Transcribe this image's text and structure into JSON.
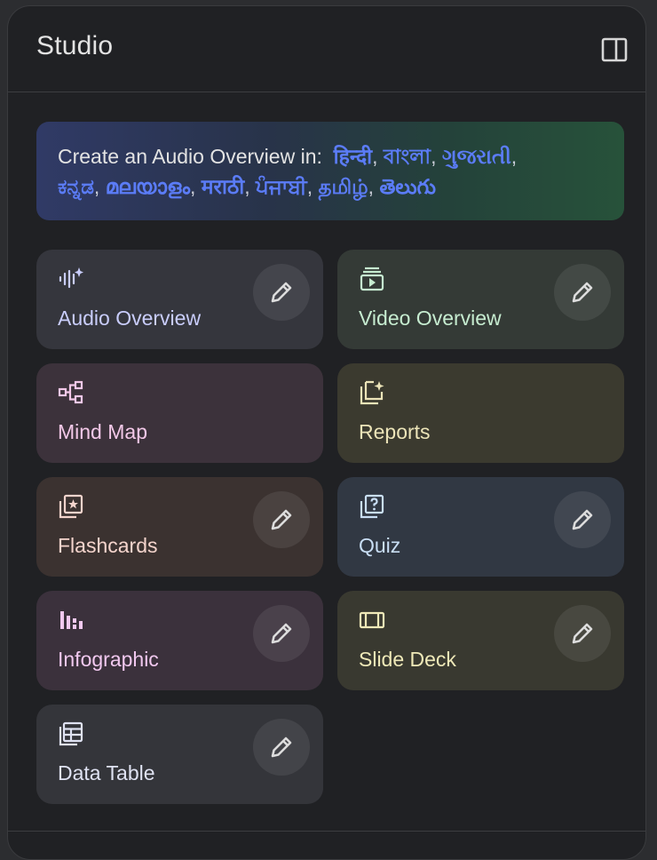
{
  "header": {
    "title": "Studio",
    "collapse_icon": "panel-toggle-icon"
  },
  "banner": {
    "prefix": "Create an Audio Overview in:",
    "languages": [
      "हिन्दी",
      "বাংলা",
      "ગુજરાતી",
      "ಕನ್ನಡ",
      "മലയാളം",
      "मराठी",
      "ਪੰਜਾਬੀ",
      "தமிழ்",
      "తెలుగు"
    ],
    "separator": ",",
    "link_color": "#5b7cf7"
  },
  "cards": [
    {
      "id": "audio",
      "label": "Audio Overview",
      "icon": "audio-waveform-sparkle-icon",
      "text_color": "#c9cdfb",
      "bg": "#35363d",
      "editable": true
    },
    {
      "id": "video",
      "label": "Video Overview",
      "icon": "video-slides-icon",
      "text_color": "#c6ecd0",
      "bg": "#343a36",
      "editable": true
    },
    {
      "id": "mind",
      "label": "Mind Map",
      "icon": "mind-map-icon",
      "text_color": "#f3c8e8",
      "bg": "#3c323b",
      "editable": false
    },
    {
      "id": "reports",
      "label": "Reports",
      "icon": "reports-sparkle-icon",
      "text_color": "#ece4b8",
      "bg": "#3b3a2f",
      "editable": false
    },
    {
      "id": "flash",
      "label": "Flashcards",
      "icon": "flashcards-icon",
      "text_color": "#f4d4cc",
      "bg": "#3b3230",
      "editable": true
    },
    {
      "id": "quiz",
      "label": "Quiz",
      "icon": "quiz-icon",
      "text_color": "#c9def4",
      "bg": "#313843",
      "editable": true
    },
    {
      "id": "info",
      "label": "Infographic",
      "icon": "infographic-icon",
      "text_color": "#f1c8ef",
      "bg": "#3b313c",
      "editable": true
    },
    {
      "id": "slide",
      "label": "Slide Deck",
      "icon": "slide-deck-icon",
      "text_color": "#efe9b8",
      "bg": "#393930",
      "editable": true
    },
    {
      "id": "table",
      "label": "Data Table",
      "icon": "data-table-icon",
      "text_color": "#dfe2f2",
      "bg": "#34353a",
      "editable": true
    }
  ],
  "edit_icon": "pencil-icon"
}
